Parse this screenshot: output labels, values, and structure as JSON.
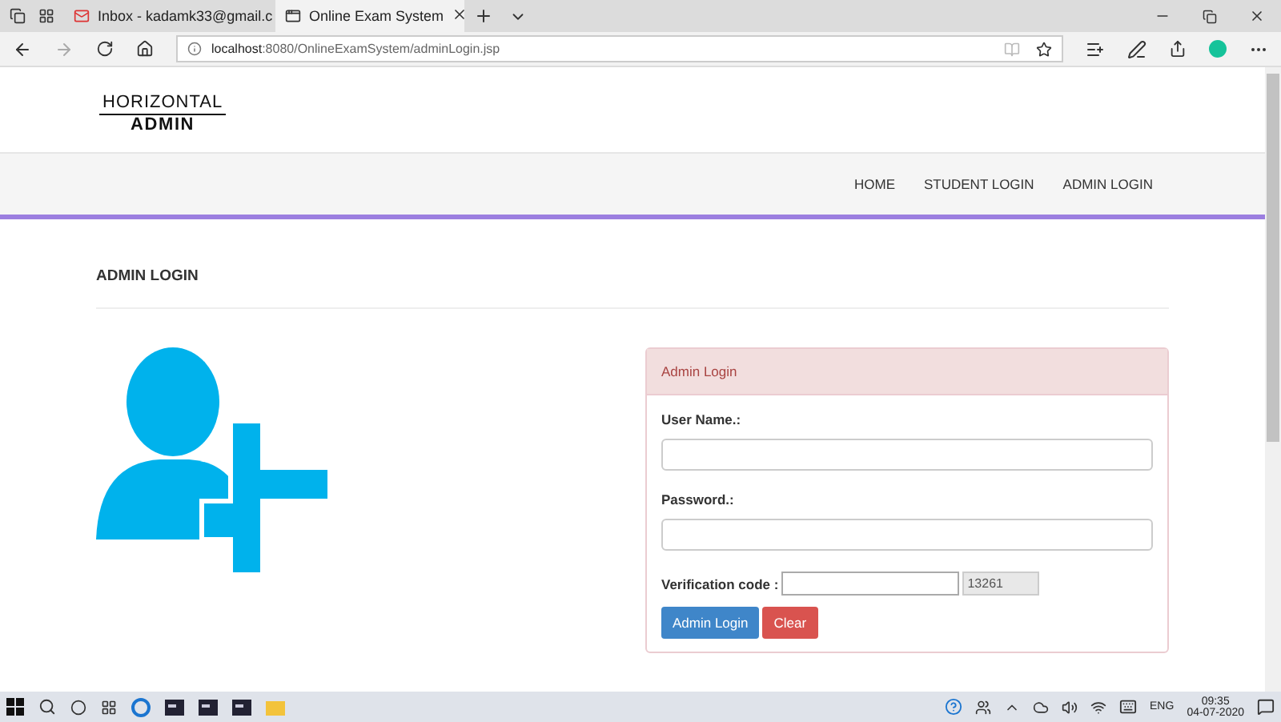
{
  "browser": {
    "tabs": [
      {
        "title": "Inbox - kadamk33@gmail.c",
        "selected": false,
        "kind": "mail"
      },
      {
        "title": "Online Exam System",
        "selected": true,
        "kind": "page"
      }
    ],
    "address": {
      "host": "localhost",
      "path": ":8080/OnlineExamSystem/adminLogin.jsp"
    }
  },
  "logo": {
    "top": "HORIZONTAL",
    "bottom": "ADMIN"
  },
  "nav": [
    {
      "label": "HOME"
    },
    {
      "label": "STUDENT LOGIN"
    },
    {
      "label": "ADMIN LOGIN"
    }
  ],
  "section_title": "ADMIN LOGIN",
  "panel": {
    "title": "Admin Login",
    "fields": [
      {
        "label": "User Name.:"
      },
      {
        "label": "Password.:"
      }
    ],
    "verification": {
      "label": "Verification code :",
      "code": "13261"
    },
    "buttons": [
      {
        "label": "Admin Login",
        "kind": "primary"
      },
      {
        "label": "Clear",
        "kind": "danger"
      }
    ]
  },
  "taskbar": {
    "language": "ENG",
    "time": "09:35",
    "date": "04-07-2020"
  }
}
